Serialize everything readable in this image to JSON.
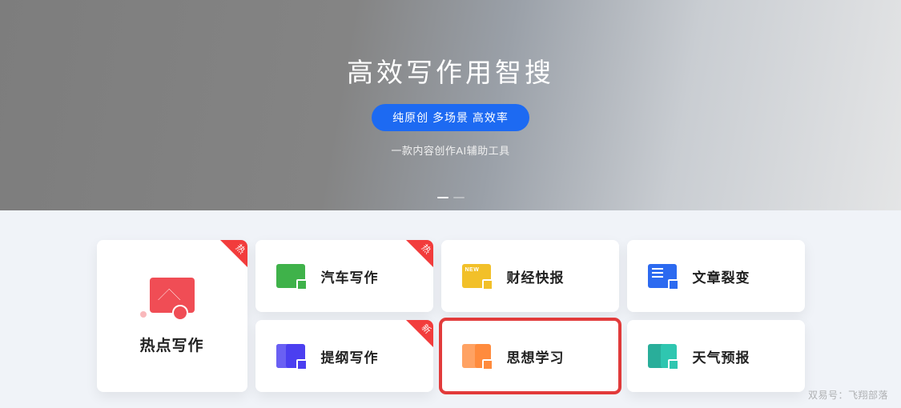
{
  "hero": {
    "title": "高效写作用智搜",
    "pill": "纯原创 多场景 高效率",
    "subtitle": "一款内容创作AI辅助工具"
  },
  "featured": {
    "label": "热点写作",
    "ribbon": "热",
    "icon": "chart-icon"
  },
  "cards": [
    {
      "label": "汽车写作",
      "ribbon": "热",
      "icon": "green",
      "highlight": false
    },
    {
      "label": "财经快报",
      "ribbon": null,
      "icon": "yellow",
      "highlight": false
    },
    {
      "label": "文章裂变",
      "ribbon": null,
      "icon": "blue2",
      "highlight": false
    },
    {
      "label": "提纲写作",
      "ribbon": "新",
      "icon": "purple",
      "highlight": false
    },
    {
      "label": "思想学习",
      "ribbon": null,
      "icon": "orange",
      "highlight": true
    },
    {
      "label": "天气预报",
      "ribbon": null,
      "icon": "teal",
      "highlight": false
    }
  ],
  "watermark": "双易号：飞翔部落"
}
